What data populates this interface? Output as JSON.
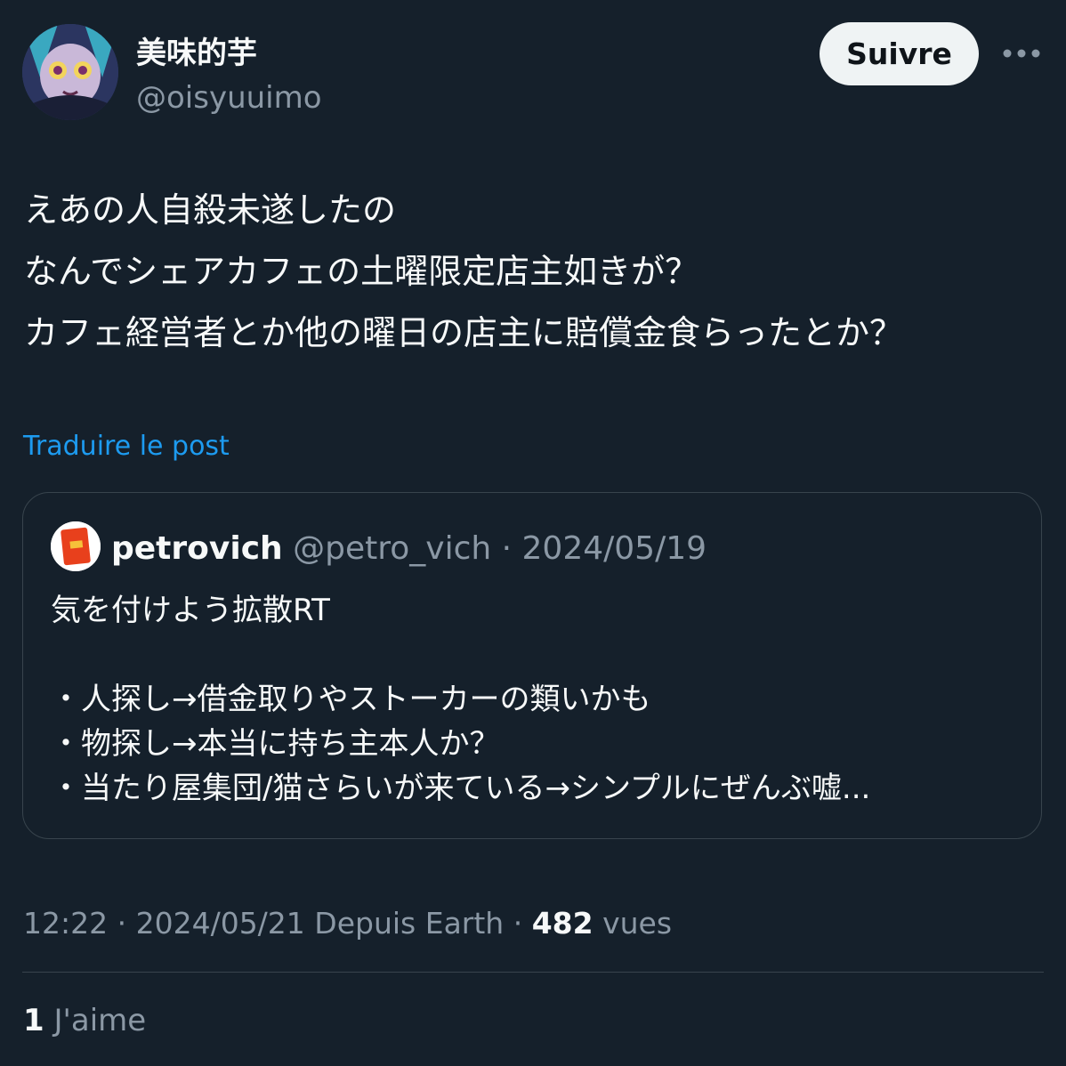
{
  "author": {
    "display_name": "美味的芋",
    "handle": "@oisyuuimo"
  },
  "header": {
    "follow_label": "Suivre",
    "more_icon": "more-horizontal-icon"
  },
  "tweet": {
    "lines": [
      "えあの人自殺未遂したの",
      "なんでシェアカフェの土曜限定店主如きが？",
      "カフェ経営者とか他の曜日の店主に賠償金食らったとか？"
    ],
    "translate_label": "Traduire le post"
  },
  "quote": {
    "name": "petrovich",
    "handle": "@petro_vich",
    "separator": " · ",
    "date": "2024/05/19",
    "lines": [
      "気を付けよう拡散RT",
      "",
      "・人探し→借金取りやストーカーの類いかも",
      "・物探し→本当に持ち主本人か？",
      "・当たり屋集団/猫さらいが来ている→シンプルにぜんぶ嘘..."
    ]
  },
  "meta": {
    "time": "12:22",
    "separator": " · ",
    "date": "2024/05/21",
    "source": "Depuis Earth",
    "views_count": "482",
    "views_label": "vues"
  },
  "likes": {
    "count": "1",
    "label": "J'aime"
  },
  "colors": {
    "background": "#15202b",
    "text_primary": "#f7f9f9",
    "text_secondary": "#8b98a5",
    "link": "#1d9bf0",
    "border": "#38444d",
    "follow_bg": "#eff3f4"
  }
}
